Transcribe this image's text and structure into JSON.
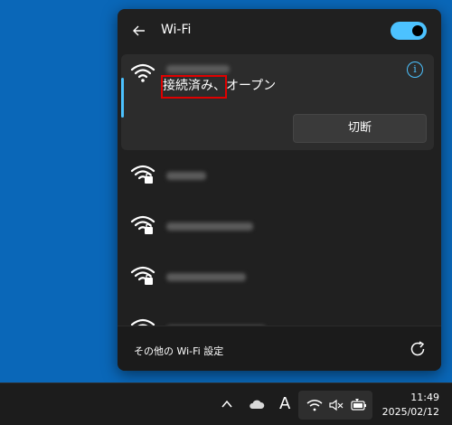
{
  "header": {
    "title": "Wi-Fi"
  },
  "active_network": {
    "status": "接続済み",
    "status_suffix": "、オープン",
    "disconnect_label": "切断"
  },
  "footer": {
    "label": "その他の Wi-Fi 設定"
  },
  "taskbar": {
    "time": "11:49",
    "date": "2025/02/12",
    "ime_label": "A"
  },
  "colors": {
    "accent": "#4cc2ff",
    "highlight": "#e00000",
    "desktop": "#0a67b8"
  },
  "icons": [
    "back-arrow-icon",
    "wifi-icon",
    "wifi-lock-icon",
    "info-icon",
    "refresh-icon",
    "chevron-up-icon",
    "cloud-icon",
    "muted-speaker-icon",
    "battery-icon"
  ]
}
